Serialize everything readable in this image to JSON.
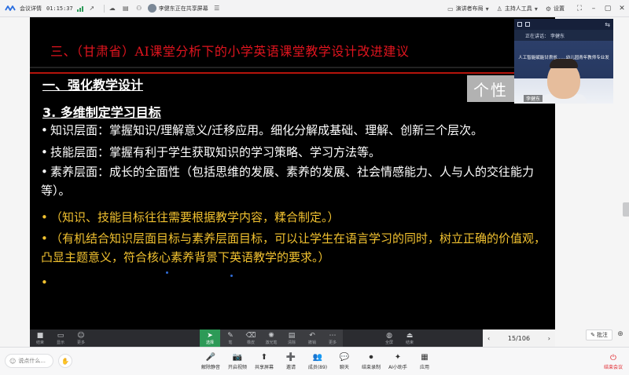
{
  "topbar": {
    "meeting_details": "会议详情",
    "timer": "01:15:37",
    "sharing_text": "李健东正在共享屏幕",
    "presenter_layout": "演讲者布局",
    "host_tools": "主持人工具",
    "settings": "设置"
  },
  "slide": {
    "title": "三、（甘肃省）AI课堂分析下的小学英语课堂教学设计改进建议",
    "section_heading": "一、强化教学设计",
    "sub_heading": "3. 多维制定学习目标",
    "badge": "个性",
    "bullets": [
      {
        "dot": "•",
        "text": "知识层面：掌握知识/理解意义/迁移应用。细化分解成基础、理解、创新三个层次。"
      },
      {
        "dot": "•",
        "text": "技能层面：掌握有利于学生获取知识的学习策略、学习方法等。"
      },
      {
        "dot": "•",
        "text": "素养层面：成长的全面性（包括思维的发展、素养的发展、社会情感能力、人与人的交往能力等）。"
      }
    ],
    "notes": [
      {
        "dot": "•",
        "text": "（知识、技能目标往往需要根据教学内容，糅合制定。）"
      },
      {
        "dot": "•",
        "text": "（有机结合知识层面目标与素养层面目标，可以让学生在语言学习的同时，树立正确的价值观，凸显主题意义，符合核心素养背景下英语教学的要求。）"
      },
      {
        "dot": "•",
        "text": ""
      }
    ],
    "text_color": "#ffffff",
    "title_color": "#e0141e",
    "note_color": "#f2c230"
  },
  "video": {
    "speaking_label": "正在讲话：",
    "speaker_name": "李健东",
    "background_text": "人工智能赋能甘肃省……幼儿园青年教师专业发展……",
    "name_tag": "李健东"
  },
  "slide_tools": {
    "left": [
      "结束",
      "显示",
      "更多"
    ],
    "draw": [
      "选择",
      "笔",
      "橡皮",
      "激光笔",
      "清除",
      "撤销",
      "更多"
    ],
    "extra": [
      "全屏",
      "结束"
    ],
    "page": "15/106"
  },
  "annotate": {
    "label": "批注"
  },
  "bottombar": {
    "chat_placeholder": "说点什么...",
    "items": [
      {
        "icon": "mic-icon",
        "glyph": "🎤",
        "label": "解除静音"
      },
      {
        "icon": "camera-icon",
        "glyph": "📷",
        "label": "开启视频"
      },
      {
        "icon": "share-screen-icon",
        "glyph": "⬆",
        "label": "共享屏幕"
      },
      {
        "icon": "invite-icon",
        "glyph": "➕",
        "label": "邀请"
      },
      {
        "icon": "members-icon",
        "glyph": "👥",
        "label": "成员(89)"
      },
      {
        "icon": "chat-icon",
        "glyph": "💬",
        "label": "聊天"
      },
      {
        "icon": "record-icon",
        "glyph": "⏺",
        "label": "结束录制"
      },
      {
        "icon": "ai-assistant-icon",
        "glyph": "✦",
        "label": "AI小助手"
      },
      {
        "icon": "apps-icon",
        "glyph": "▦",
        "label": "应用"
      }
    ],
    "end_meeting": "结束会议"
  }
}
